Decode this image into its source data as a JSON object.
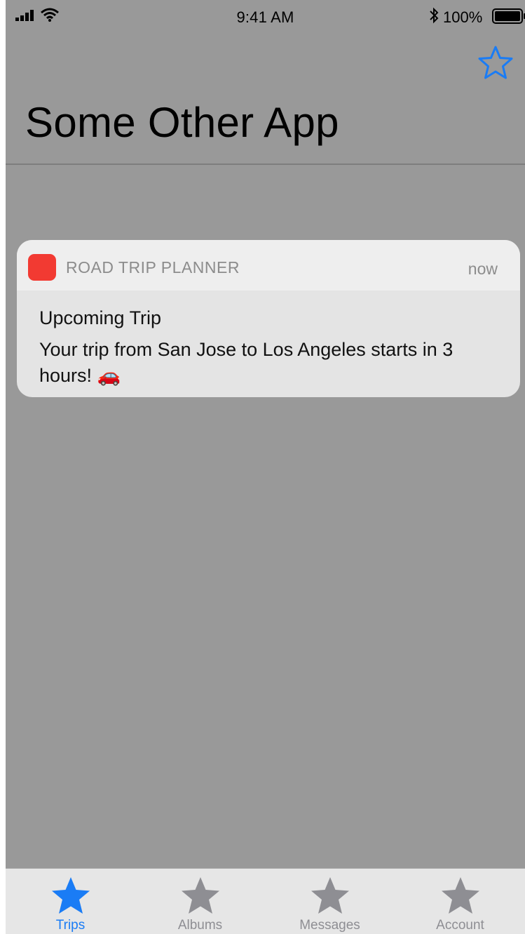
{
  "status_bar": {
    "time": "9:41 AM",
    "battery_percent": "100%",
    "icons": [
      "signal-icon",
      "wifi-icon",
      "bluetooth-icon",
      "battery-icon"
    ]
  },
  "nav": {
    "title": "Some Other App",
    "favorite_icon": "star-outline-icon"
  },
  "notification": {
    "app_name": "ROAD TRIP PLANNER",
    "time": "now",
    "title": "Upcoming Trip",
    "body": "Your trip from San Jose to Los Angeles starts in 3 hours! 🚗",
    "icon_color": "#f23a32"
  },
  "tab_bar": {
    "items": [
      {
        "label": "Trips",
        "icon": "star-icon",
        "active": true
      },
      {
        "label": "Albums",
        "icon": "star-icon",
        "active": false
      },
      {
        "label": "Messages",
        "icon": "star-icon",
        "active": false
      },
      {
        "label": "Account",
        "icon": "star-icon",
        "active": false
      }
    ],
    "active_color": "#1a7cf5",
    "inactive_color": "#8e8e93"
  },
  "colors": {
    "background": "#999999",
    "notification_bg": "#e4e4e4",
    "notification_header_bg": "#eeeeee",
    "accent": "#1a7cf5"
  }
}
